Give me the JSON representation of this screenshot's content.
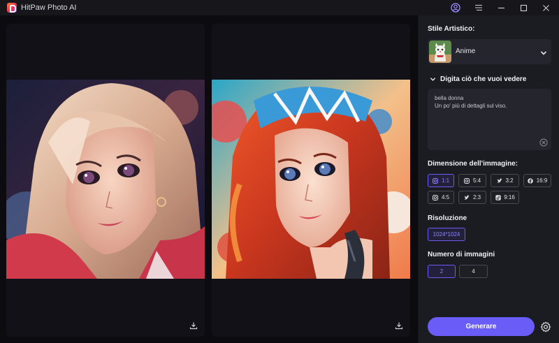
{
  "window": {
    "title": "HitPaw Photo AI",
    "icons": [
      "app-logo",
      "user-icon",
      "menu-icon",
      "minimize-icon",
      "maximize-icon",
      "close-icon"
    ]
  },
  "results": [
    {
      "name": "blonde-anime-portrait",
      "download_icon": "download-icon"
    },
    {
      "name": "red-hair-anime-portrait",
      "download_icon": "download-icon"
    }
  ],
  "sidebar": {
    "style_label": "Stile Artistico:",
    "style_value": "Anime",
    "prompt_label": "Digita ciò che vuoi vedere",
    "prompt_lines": [
      "bella donna",
      "Un po' più di dettagli sul viso."
    ],
    "size_label": "Dimensione dell'immagine:",
    "ratios": [
      {
        "label": "1:1",
        "icon": "instagram-icon",
        "active": true
      },
      {
        "label": "5:4",
        "icon": "instagram-icon",
        "active": false
      },
      {
        "label": "3:2",
        "icon": "twitter-icon",
        "active": false
      },
      {
        "label": "16:9",
        "icon": "facebook-icon",
        "active": false
      },
      {
        "label": "4:5",
        "icon": "instagram-icon",
        "active": false
      },
      {
        "label": "2:3",
        "icon": "twitter-icon",
        "active": false
      },
      {
        "label": "9:16",
        "icon": "tiktok-icon",
        "active": false
      }
    ],
    "resolution_label": "Risoluzione",
    "resolution_value": "1024*1024",
    "count_label": "Numero di immagini",
    "counts": [
      {
        "label": "2",
        "active": true
      },
      {
        "label": "4",
        "active": false
      }
    ],
    "generate_label": "Generare"
  },
  "colors": {
    "accent": "#6a5cf7",
    "accent_text": "#8e84ff",
    "panel": "#1b1b22",
    "background": "#0c0c10"
  }
}
